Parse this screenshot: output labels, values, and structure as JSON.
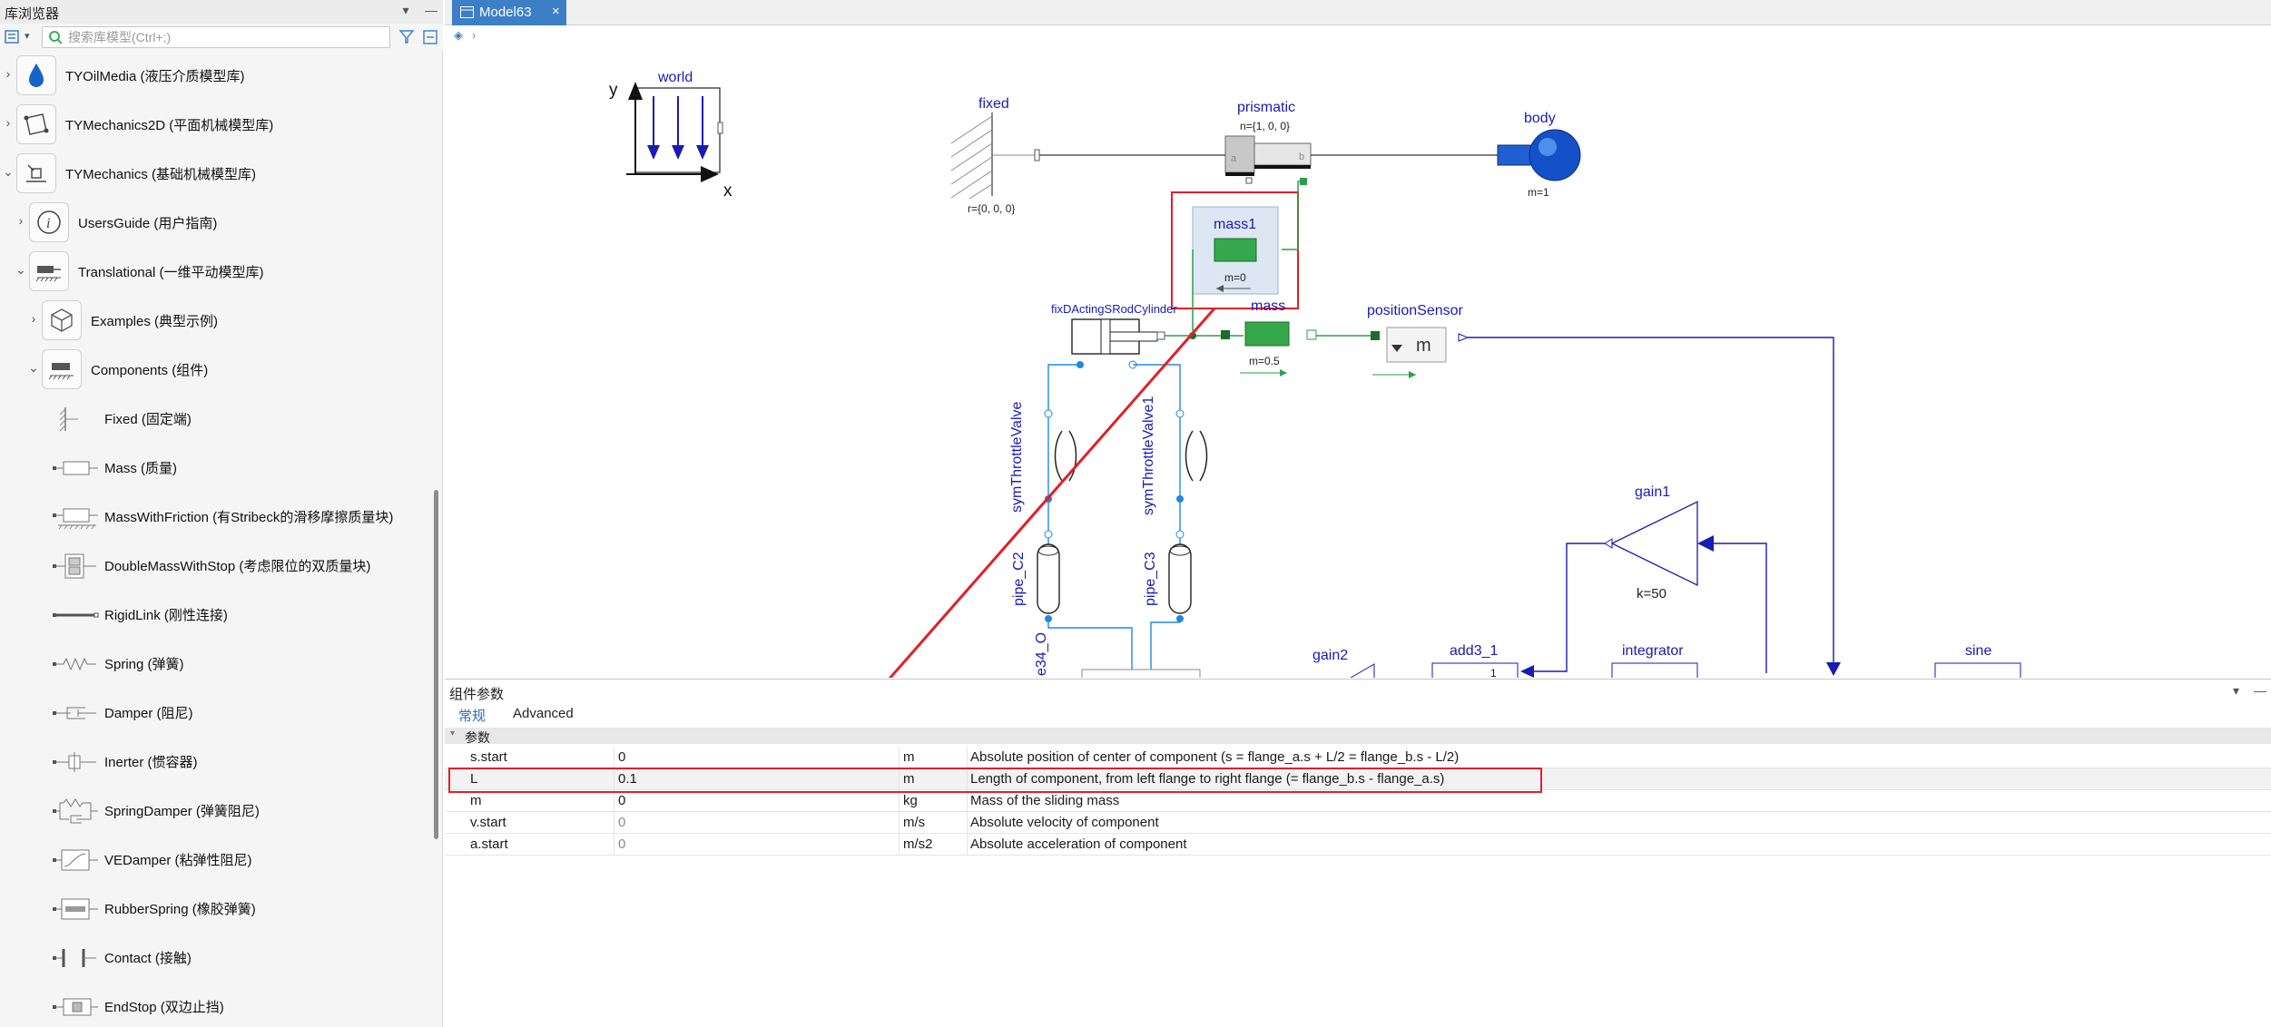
{
  "library": {
    "title": "库浏览器",
    "search_placeholder": "搜索库模型(Ctrl+;)",
    "items": [
      {
        "label": "TYOilMedia (液压介质模型库)",
        "icon": "oil-drop-icon"
      },
      {
        "label": "TYMechanics2D (平面机械模型库)",
        "icon": "mechanics2d-icon"
      },
      {
        "label": "TYMechanics (基础机械模型库)",
        "icon": "mechanics-icon"
      },
      {
        "label": "UsersGuide (用户指南)",
        "icon": "info-icon"
      },
      {
        "label": "Translational (一维平动模型库)",
        "icon": "translational-icon"
      },
      {
        "label": "Examples (典型示例)",
        "icon": "cube-icon"
      },
      {
        "label": "Components (组件)",
        "icon": "components-icon"
      },
      {
        "label": "Fixed (固定端)",
        "icon": "fixed-icon"
      },
      {
        "label": "Mass (质量)",
        "icon": "mass-icon"
      },
      {
        "label": "MassWithFriction (有Stribeck的滑移摩擦质量块)",
        "icon": "mass-friction-icon"
      },
      {
        "label": "DoubleMassWithStop (考虑限位的双质量块)",
        "icon": "double-mass-icon"
      },
      {
        "label": "RigidLink (刚性连接)",
        "icon": "rigid-link-icon"
      },
      {
        "label": "Spring (弹簧)",
        "icon": "spring-icon"
      },
      {
        "label": "Damper (阻尼)",
        "icon": "damper-icon"
      },
      {
        "label": "Inerter (惯容器)",
        "icon": "inerter-icon"
      },
      {
        "label": "SpringDamper (弹簧阻尼)",
        "icon": "spring-damper-icon"
      },
      {
        "label": "VEDamper (粘弹性阻尼)",
        "icon": "ve-damper-icon"
      },
      {
        "label": "RubberSpring (橡胶弹簧)",
        "icon": "rubber-spring-icon"
      },
      {
        "label": "Contact (接触)",
        "icon": "contact-icon"
      },
      {
        "label": "EndStop (双边止挡)",
        "icon": "endstop-icon"
      }
    ]
  },
  "editor": {
    "tab_label": "Model63",
    "diagram": {
      "world": "world",
      "axis_y": "y",
      "axis_x": "x",
      "fixed": "fixed",
      "fixed_param": "r={0, 0, 0}",
      "prismatic": "prismatic",
      "prismatic_param": "n={1, 0, 0}",
      "prismatic_port_a": "a",
      "prismatic_port_b": "b",
      "body": "body",
      "body_param": "m=1",
      "mass1": "mass1",
      "mass1_param": "m=0",
      "cylinder": "fixDActingSRodCylinder",
      "mass": "mass",
      "mass_param": "m=0.5",
      "position_sensor": "positionSensor",
      "sensor_glyph": "m",
      "valve": "symThrottleValve",
      "valve1": "symThrottleValve1",
      "pipe_c2": "pipe_C2",
      "pipe_c3": "pipe_C3",
      "pipe_partial": "e34_O",
      "gain1": "gain1",
      "gain1_param": "k=50",
      "gain2": "gain2",
      "add3": "add3_1",
      "add3_glyph": "1",
      "integrator": "integrator",
      "sine": "sine"
    }
  },
  "params": {
    "title": "组件参数",
    "tabs": [
      "常规",
      "Advanced"
    ],
    "group": "参数",
    "rows": [
      {
        "name": "s.start",
        "value": "0",
        "unit": "m",
        "desc": "Absolute position of center of component (s = flange_a.s + L/2 = flange_b.s - L/2)"
      },
      {
        "name": "L",
        "value": "0.1",
        "unit": "m",
        "desc": "Length of component, from left flange to right flange (= flange_b.s - flange_a.s)"
      },
      {
        "name": "m",
        "value": "0",
        "unit": "kg",
        "desc": "Mass of the sliding mass"
      },
      {
        "name": "v.start",
        "value": "0",
        "unit": "m/s",
        "desc": "Absolute velocity of component"
      },
      {
        "name": "a.start",
        "value": "0",
        "unit": "m/s2",
        "desc": "Absolute acceleration of component"
      }
    ]
  },
  "colors": {
    "accent": "#3c7fc6",
    "highlight": "#e0202a",
    "label_blue": "#1a1ab4",
    "mass_green": "#2e9e4a"
  }
}
